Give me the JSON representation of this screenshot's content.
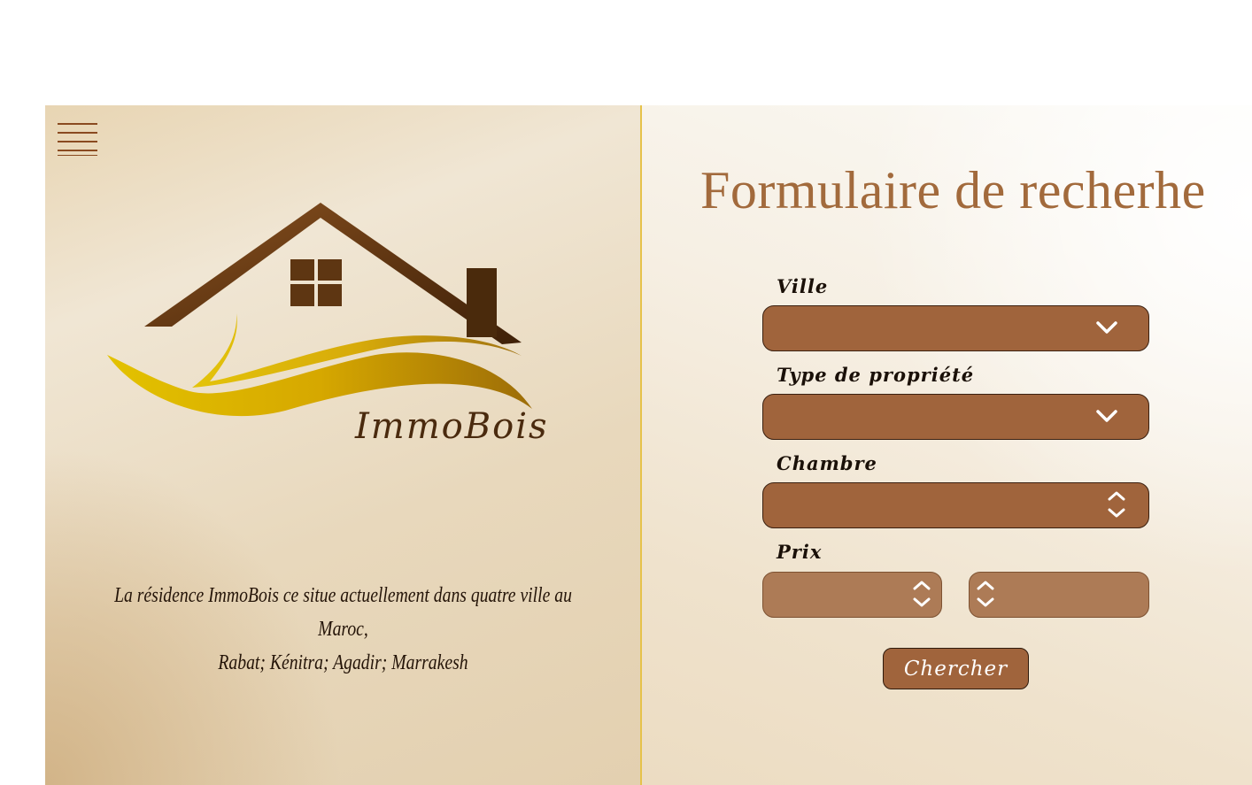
{
  "brand": {
    "name": "ImmoBois"
  },
  "description": {
    "line1": "La résidence ImmoBois ce situe actuellement dans quatre ville au Maroc,",
    "line2": "Rabat; Kénitra; Agadir; Marrakesh"
  },
  "form": {
    "title": "Formulaire de recherhe",
    "fields": {
      "ville": {
        "label": "Ville",
        "value": ""
      },
      "type": {
        "label": "Type de propriété",
        "value": ""
      },
      "chambre": {
        "label": "Chambre",
        "value": ""
      },
      "prix": {
        "label": "Prix",
        "min_value": "",
        "max_value": ""
      }
    },
    "submit_label": "Chercher"
  },
  "icons": {
    "menu": "hamburger-menu-icon",
    "select": "chevron-down-icon",
    "number": "stepper-icon"
  },
  "colors": {
    "field_bg": "#a0643c",
    "title": "#a26a3c",
    "divider": "#e6c24a",
    "logo_brown": "#5a3210",
    "logo_gold": "#d9a400"
  }
}
